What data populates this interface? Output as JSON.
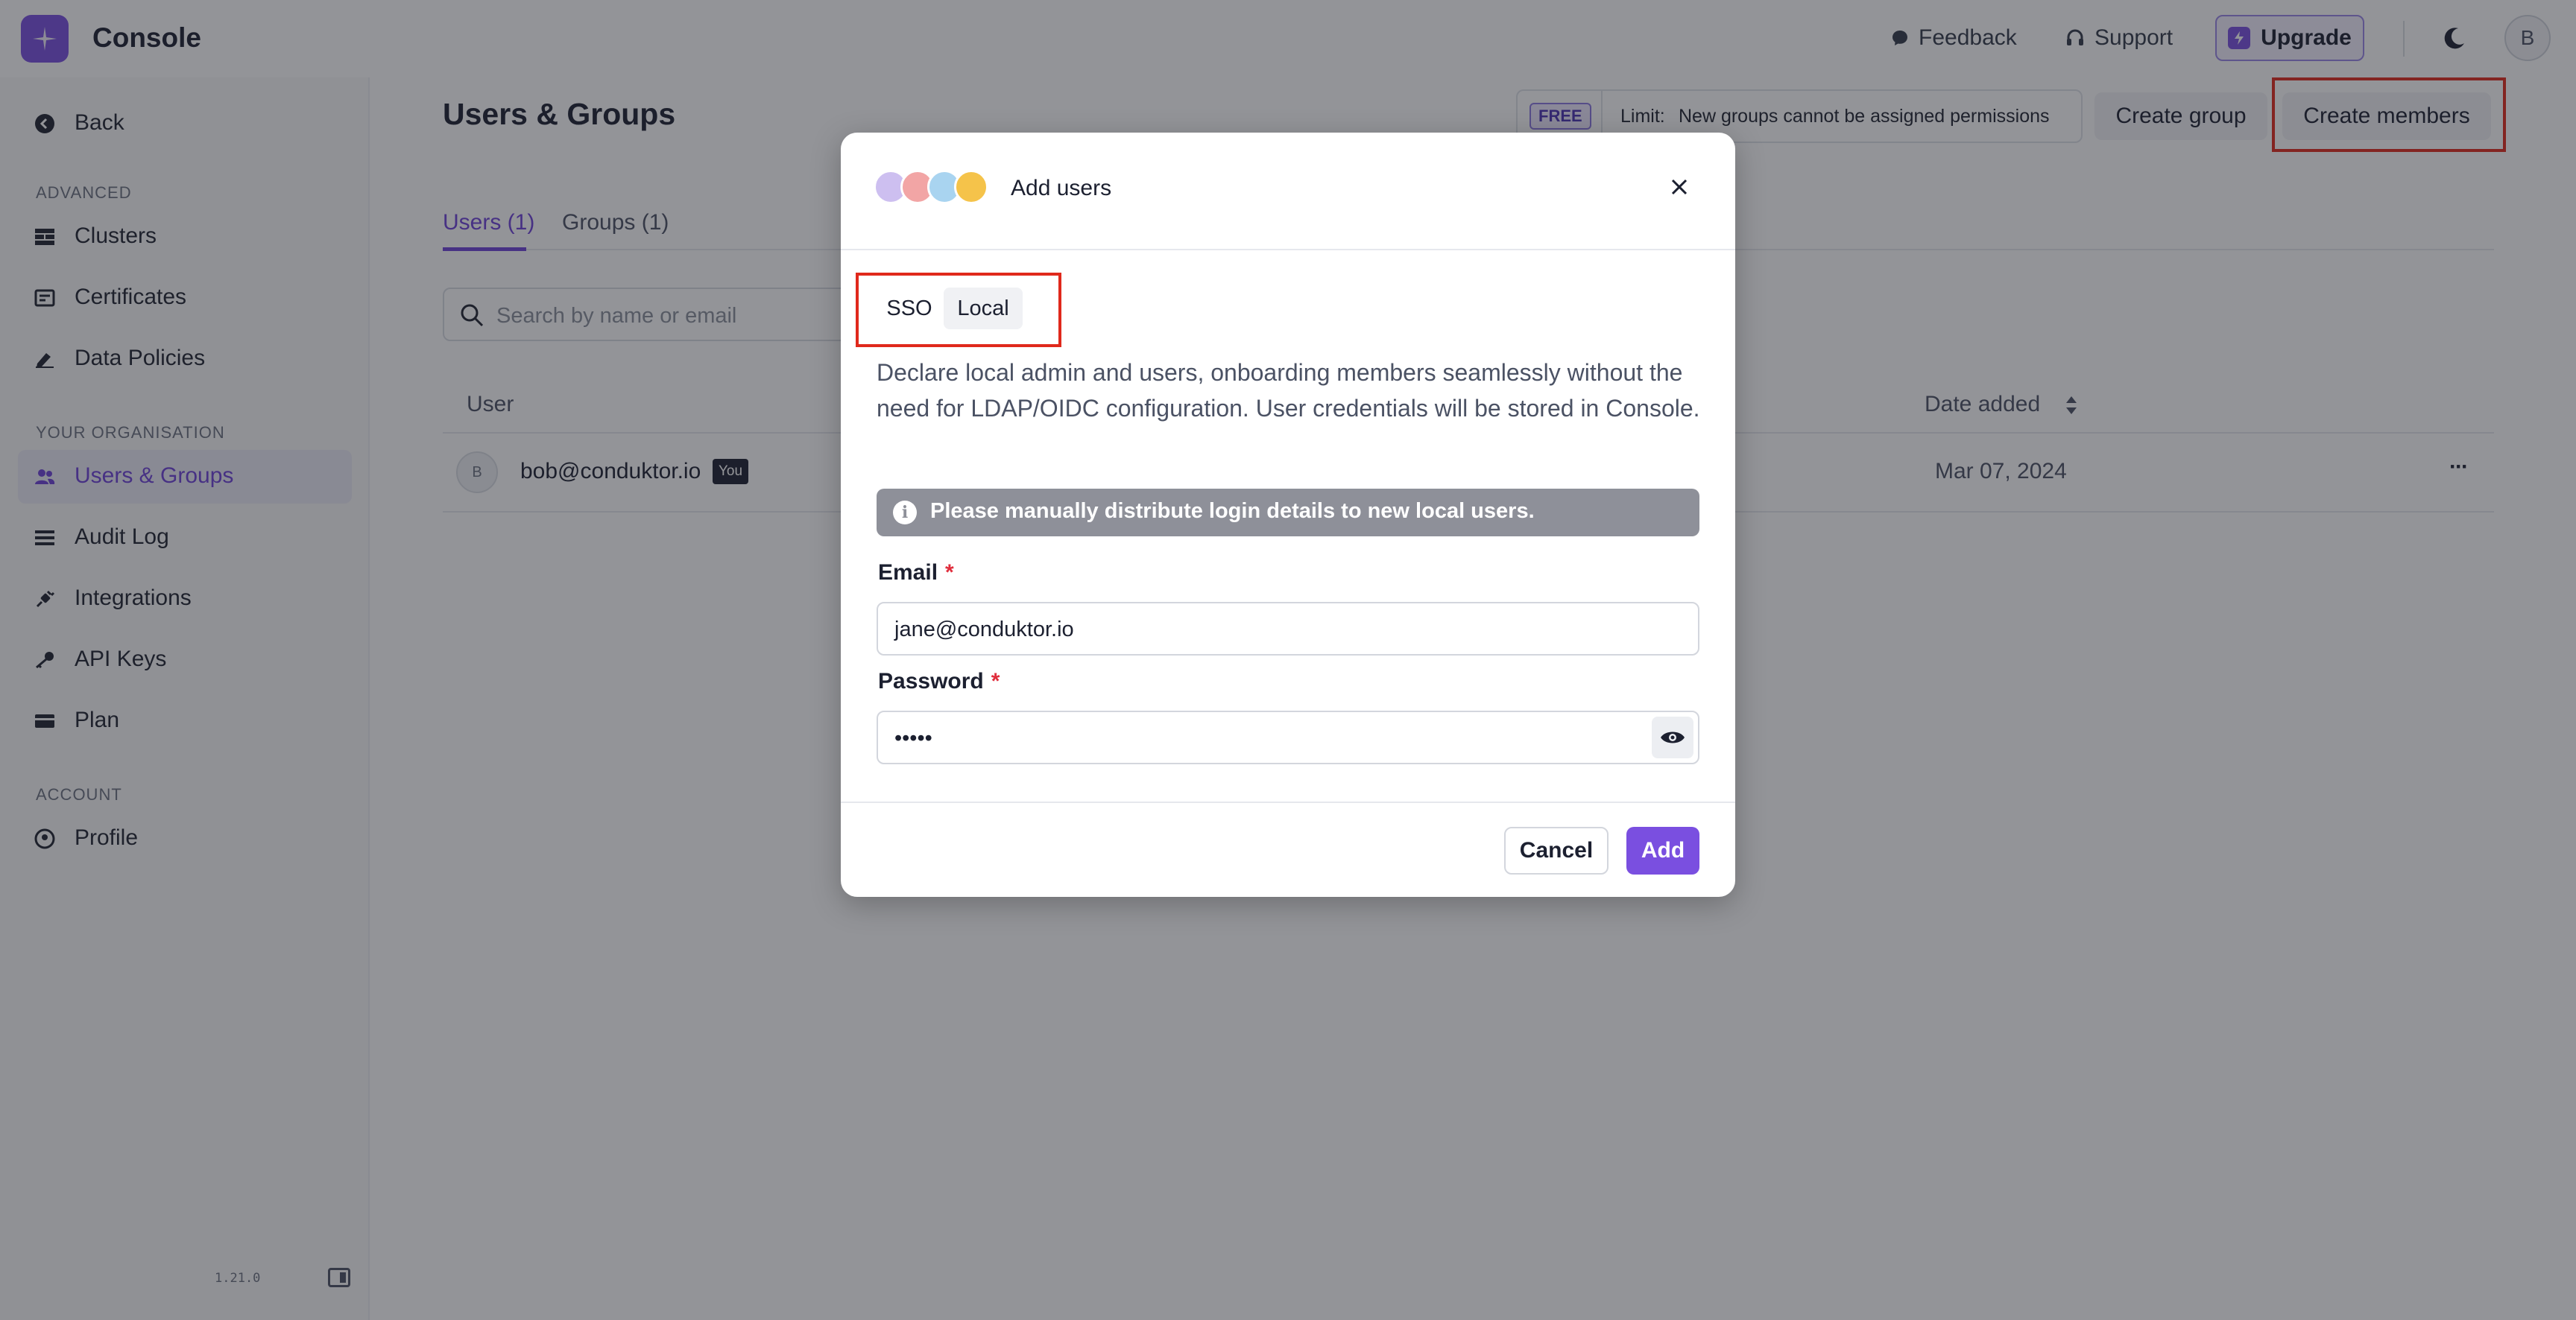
{
  "app": {
    "title": "Console"
  },
  "header": {
    "feedback_label": "Feedback",
    "support_label": "Support",
    "upgrade_label": "Upgrade",
    "avatar_initial": "B"
  },
  "sidebar": {
    "back_label": "Back",
    "section_advanced": "ADVANCED",
    "advanced_items": [
      {
        "label": "Clusters",
        "icon": "clusters-icon"
      },
      {
        "label": "Certificates",
        "icon": "certificate-icon"
      },
      {
        "label": "Data Policies",
        "icon": "pen-icon"
      }
    ],
    "section_org": "YOUR ORGANISATION",
    "org_items": [
      {
        "label": "Users & Groups",
        "icon": "users-icon",
        "active": true
      },
      {
        "label": "Audit Log",
        "icon": "list-icon"
      },
      {
        "label": "Integrations",
        "icon": "plug-icon"
      },
      {
        "label": "API Keys",
        "icon": "key-icon"
      },
      {
        "label": "Plan",
        "icon": "card-icon"
      }
    ],
    "section_account": "ACCOUNT",
    "account_items": [
      {
        "label": "Profile",
        "icon": "profile-icon"
      }
    ],
    "version": "1.21.0"
  },
  "main": {
    "page_title": "Users & Groups",
    "limit": {
      "badge": "FREE",
      "label": "Limit:",
      "text": "New groups cannot be assigned permissions"
    },
    "create_group_label": "Create group",
    "create_members_label": "Create members",
    "tabs": [
      {
        "label": "Users (1)",
        "active": true
      },
      {
        "label": "Groups (1)",
        "active": false
      }
    ],
    "search_placeholder": "Search by name or email",
    "table": {
      "columns": [
        "User",
        "Date added"
      ],
      "rows": [
        {
          "avatar": "B",
          "email": "bob@conduktor.io",
          "badge": "You",
          "date_added": "Mar 07, 2024",
          "more": "···"
        }
      ]
    }
  },
  "modal": {
    "title": "Add users",
    "tabs": [
      {
        "label": "SSO",
        "active": false
      },
      {
        "label": "Local",
        "active": true
      }
    ],
    "description": "Declare local admin and users, onboarding members seamlessly without the need for LDAP/OIDC configuration. User credentials will be stored in Console.",
    "info": "Please manually distribute login details to new local users.",
    "email_label": "Email",
    "email_value": "jane@conduktor.io",
    "password_label": "Password",
    "password_value": "•••••",
    "required_mark": "*",
    "cancel_label": "Cancel",
    "add_label": "Add"
  },
  "colors": {
    "accent": "#7a4fe0",
    "highlight_box": "#e0291c",
    "overlay": "rgba(30,32,40,0.48)"
  }
}
